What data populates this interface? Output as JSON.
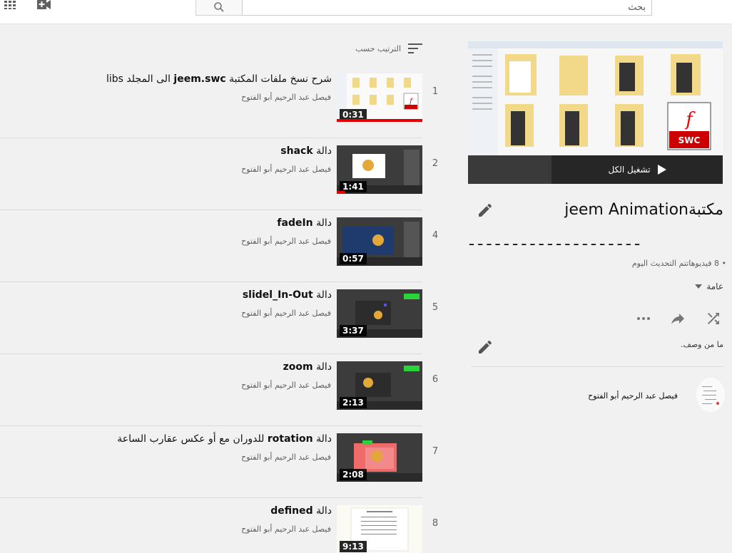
{
  "header": {
    "search_placeholder": "بحث"
  },
  "sort": {
    "label": "الترتيب حسب"
  },
  "videos": [
    {
      "index": "1",
      "title_prefix": "شرح نسخ ملفات المكتبة ",
      "title_bold": "jeem.swc",
      "title_suffix": " الى المجلد libs",
      "channel": "فيصل عبد الرحيم أبو الفتوح",
      "duration": "0:31",
      "watched": 1.0
    },
    {
      "index": "2",
      "title_prefix": "دالة ",
      "title_bold": "shack",
      "title_suffix": "",
      "channel": "فيصل عبد الرحيم أبو الفتوح",
      "duration": "1:41",
      "watched": 0.1
    },
    {
      "index": "4",
      "title_prefix": "دالة ",
      "title_bold": "fadeIn",
      "title_suffix": "",
      "channel": "فيصل عبد الرحيم أبو الفتوح",
      "duration": "0:57",
      "watched": 0
    },
    {
      "index": "5",
      "title_prefix": "دالة ",
      "title_bold": "slidel_In-Out",
      "title_suffix": "",
      "channel": "فيصل عبد الرحيم أبو الفتوح",
      "duration": "3:37",
      "watched": 0
    },
    {
      "index": "6",
      "title_prefix": "دالة ",
      "title_bold": "zoom",
      "title_suffix": "",
      "channel": "فيصل عبد الرحيم أبو الفتوح",
      "duration": "2:13",
      "watched": 0
    },
    {
      "index": "7",
      "title_prefix": "دالة ",
      "title_bold": "rotation",
      "title_suffix": " للدوران مع أو عكس عقارب الساعة",
      "channel": "فيصل عبد الرحيم أبو الفتوح",
      "duration": "2:08",
      "watched": 0
    },
    {
      "index": "8",
      "title_prefix": "دالة ",
      "title_bold": "defined",
      "title_suffix": "",
      "channel": "فيصل عبد الرحيم أبو الفتوح",
      "duration": "9:13",
      "watched": 0
    }
  ],
  "playlist": {
    "play_all": "تشغيل الكل",
    "title": "مكتبةjeem Animation",
    "subtitle": "ـ ـ ـ ـ ـ ـ ـ ـ ـ ـ ـ ـ ـ ـ ـ ـ ـ ـ ـ ـ",
    "stats": "• 8 فيديوهاتتم التحديث اليوم",
    "privacy": "عامة",
    "description": "ما من وصف.",
    "owner": "فيصل عبد الرحيم أبو الفتوح"
  },
  "colors": {
    "progress": "#e00000",
    "accent": "#606060"
  }
}
